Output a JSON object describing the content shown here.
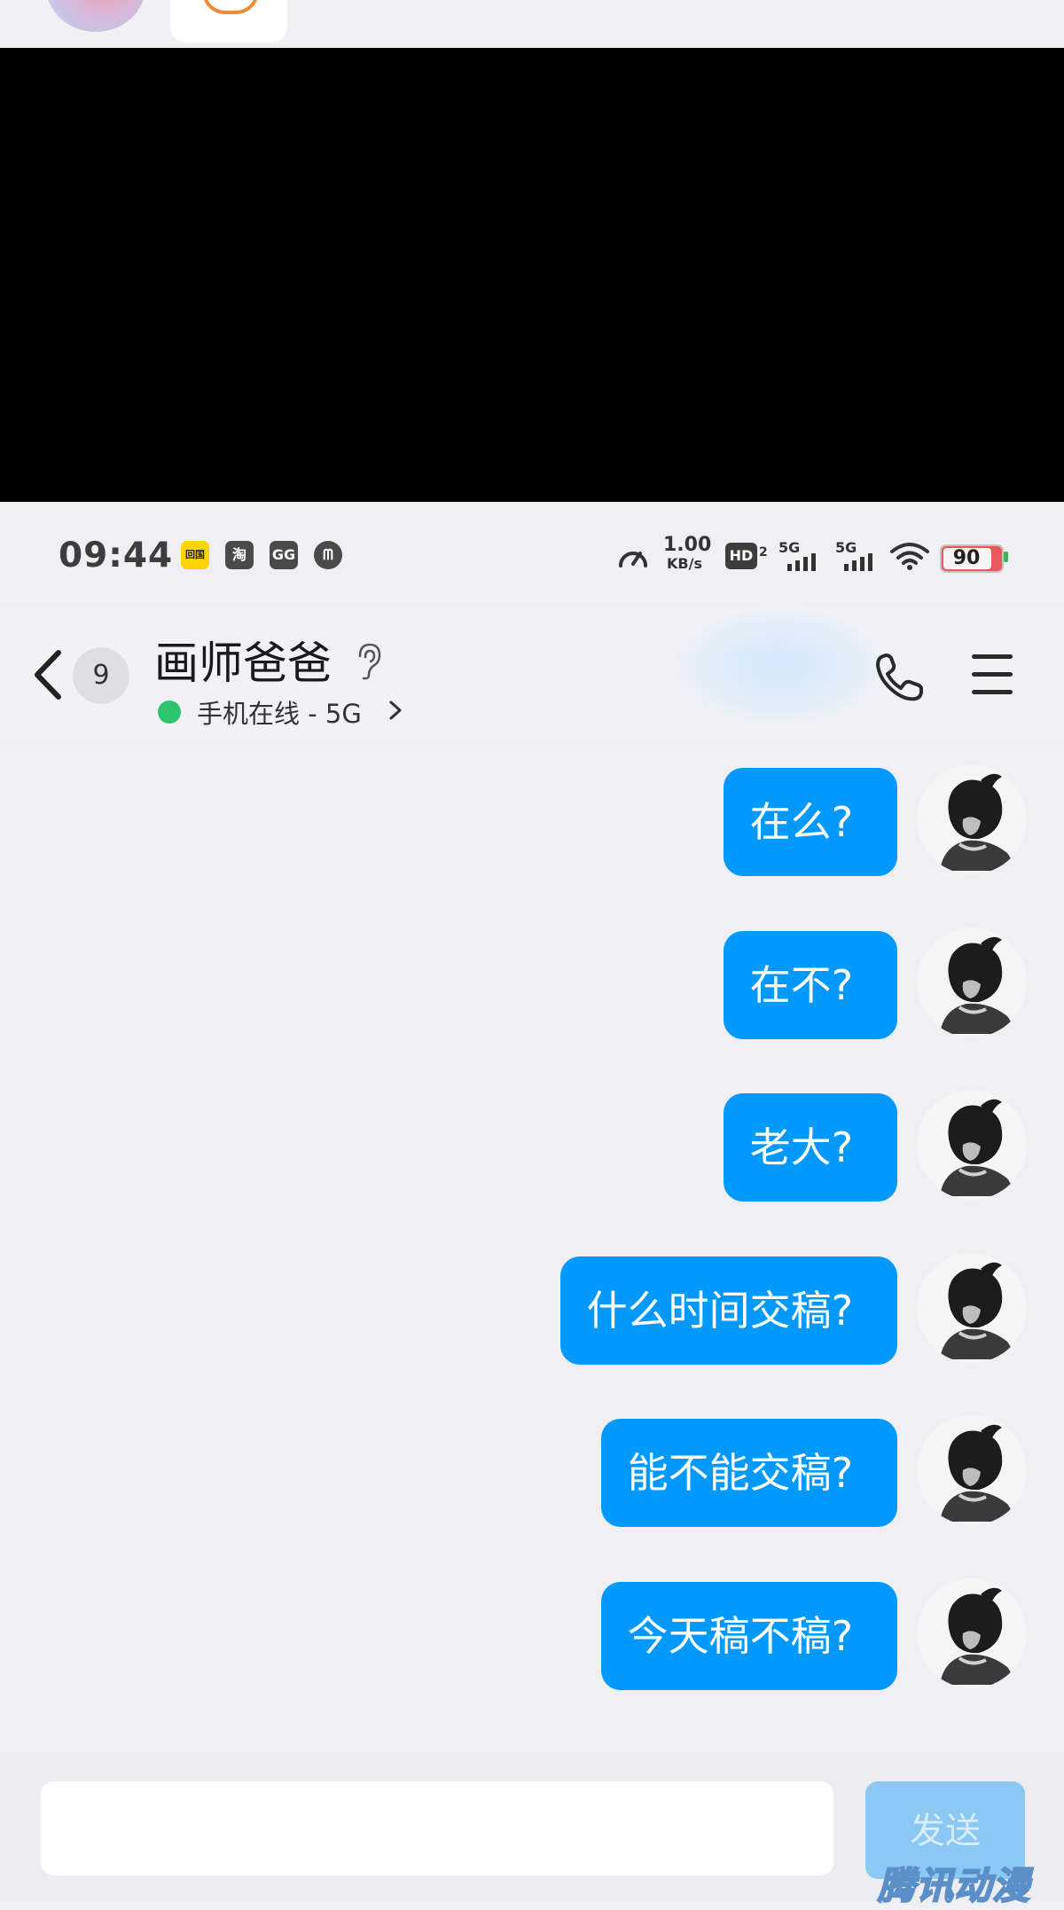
{
  "status_bar": {
    "time": "09:44",
    "app_icons": [
      "回国",
      "淘",
      "GG",
      "ᗰ"
    ],
    "speed_value": "1.00",
    "speed_unit": "KB/s",
    "hd_label": "HD",
    "hd_sub": "2",
    "sim1_label": "5G",
    "sim2_label": "5G",
    "battery": "90",
    "battery_level": 0.9
  },
  "header": {
    "unread_count": "9",
    "contact_name": "画师爸爸",
    "online_status": "手机在线 - 5G"
  },
  "messages": [
    {
      "text": "在么?"
    },
    {
      "text": "在不?"
    },
    {
      "text": "老大?"
    },
    {
      "text": "什么时间交稿?"
    },
    {
      "text": "能不能交稿?"
    },
    {
      "text": "今天稿不稿?"
    }
  ],
  "input_bar": {
    "input_value": "",
    "send_label": "发送",
    "watermark": "腾讯动漫"
  },
  "colors": {
    "bubble": "#0099ff",
    "online": "#2cc46d",
    "send_button": "#8cc8f4",
    "battery_low": "#e85a5a"
  },
  "icons": {
    "back": "chevron-left-icon",
    "ear": "ear-icon",
    "call": "phone-icon",
    "menu": "menu-icon",
    "status_chevron": "chevron-right-icon",
    "wifi": "wifi-icon",
    "speed": "speed-gauge-icon"
  }
}
